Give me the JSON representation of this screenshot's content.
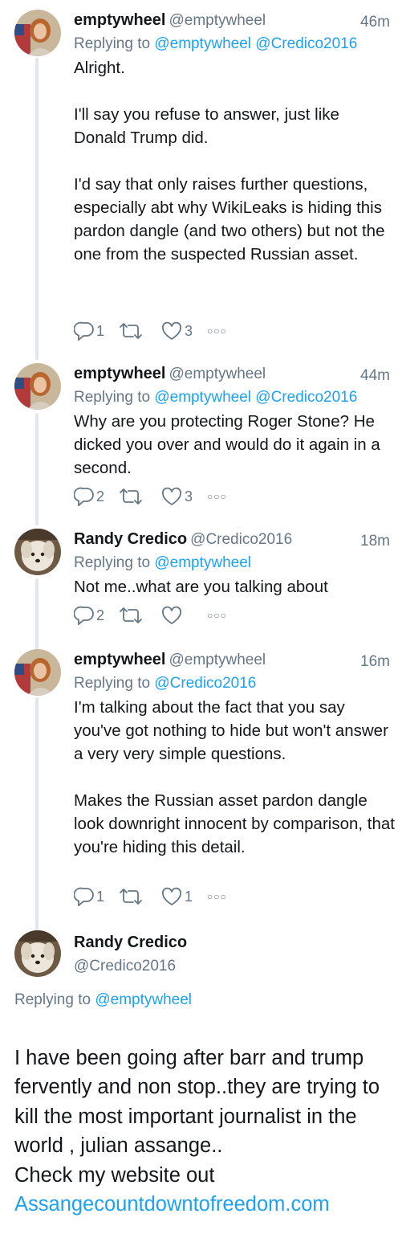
{
  "tweets": [
    {
      "name": "emptywheel",
      "handle": "@emptywheel",
      "time": "46m",
      "replying_prefix": "Replying to",
      "replying_to": "@emptywheel @Credico2016",
      "text": "Alright.\n\nI'll say you refuse to answer, just like Donald Trump did.\n\nI'd say that only raises further questions, especially abt why WikiLeaks is hiding this pardon dangle (and two others) but not the one from the suspected Russian asset.",
      "replies": "1",
      "retweets": "",
      "likes": "3"
    },
    {
      "name": "emptywheel",
      "handle": "@emptywheel",
      "time": "44m",
      "replying_prefix": "Replying to",
      "replying_to": "@emptywheel @Credico2016",
      "text": "Why are you protecting Roger Stone? He dicked you over and would do it again in a second.",
      "replies": "2",
      "retweets": "",
      "likes": "3"
    },
    {
      "name": "Randy Credico",
      "handle": "@Credico2016",
      "time": "18m",
      "replying_prefix": "Replying to",
      "replying_to": "@emptywheel",
      "text": "Not me..what are you talking about",
      "replies": "2",
      "retweets": "",
      "likes": ""
    },
    {
      "name": "emptywheel",
      "handle": "@emptywheel",
      "time": "16m",
      "replying_prefix": "Replying to",
      "replying_to": "@Credico2016",
      "text": "I'm talking about the fact that you say you've got nothing to hide but won't answer a very very simple questions.\n\nMakes the Russian asset pardon dangle look downright innocent by comparison, that you're hiding this detail.",
      "replies": "1",
      "retweets": "",
      "likes": "1"
    }
  ],
  "focused": {
    "name": "Randy Credico",
    "handle": "@Credico2016",
    "replying_prefix": "Replying to",
    "replying_to": "@emptywheel",
    "text": "I have been going after barr and trump fervently and non stop..they are trying to kill the most important journalist in the world , julian assange..\nCheck my website out",
    "link": "Assangecountdowntofreedom.com"
  },
  "icons": {
    "reply": "reply-icon",
    "retweet": "retweet-icon",
    "like": "heart-icon",
    "more": "more-icon"
  },
  "colors": {
    "link": "#1da1f2",
    "secondary": "#657786",
    "thread_line": "#e1e8ed"
  }
}
